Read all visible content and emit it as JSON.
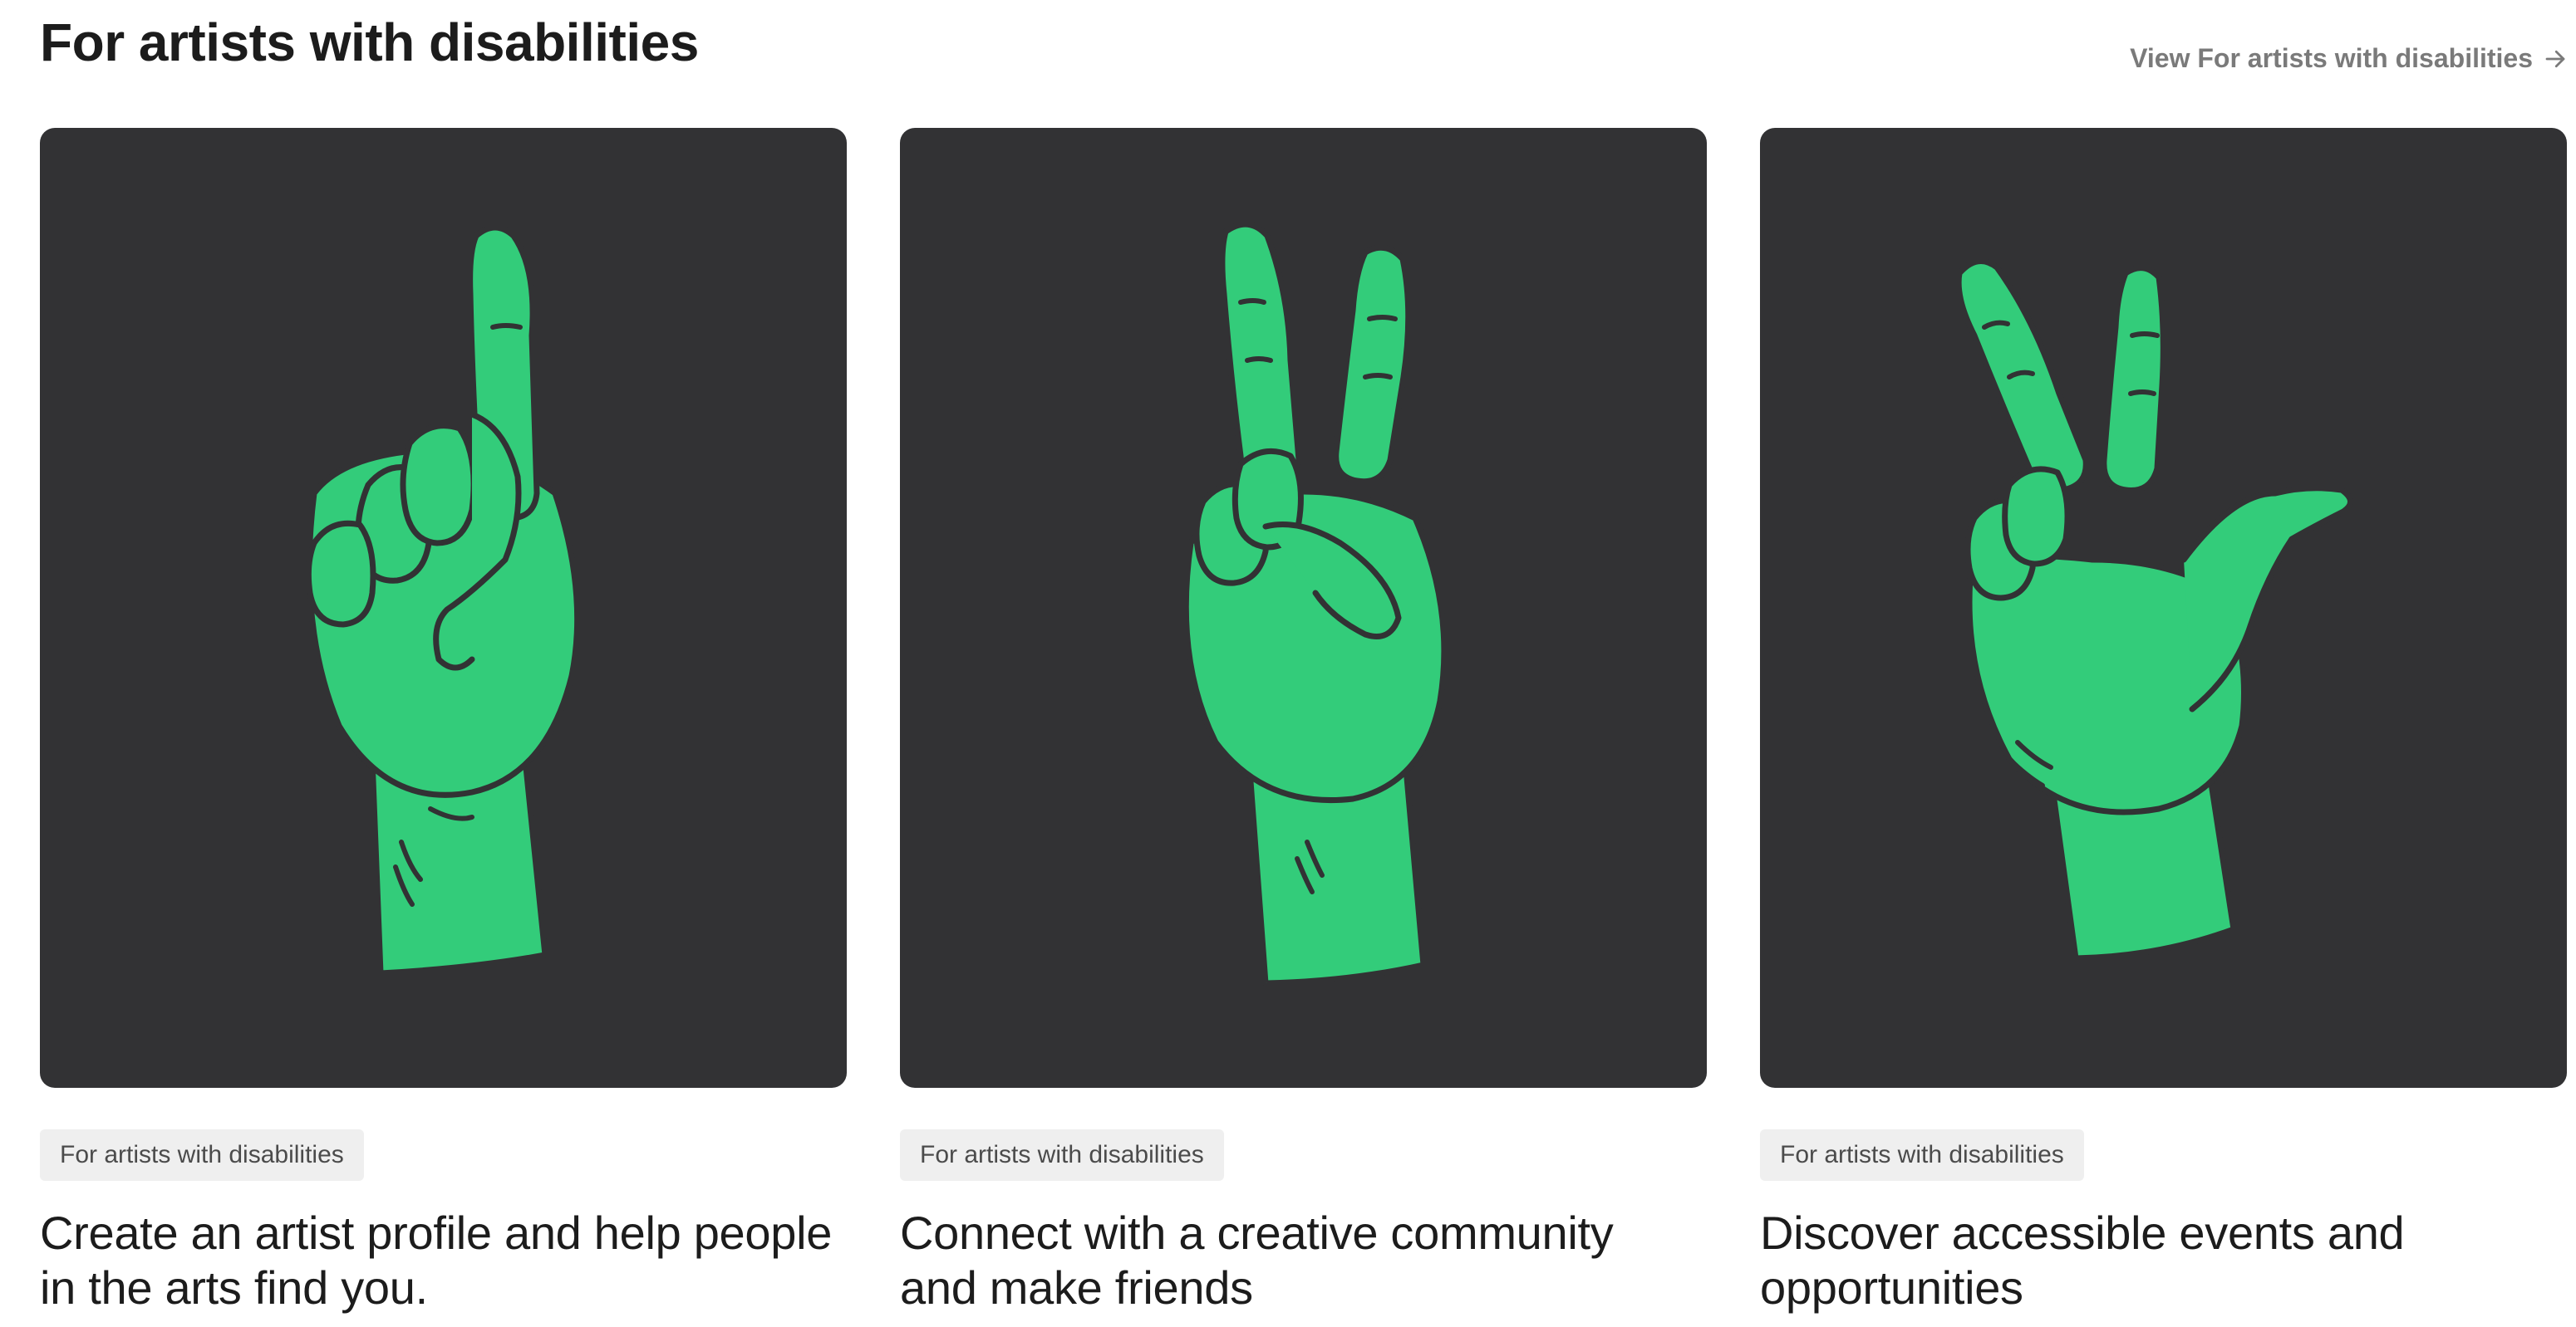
{
  "section": {
    "title": "For artists with disabilities",
    "view_all_label": "View For artists with disabilities",
    "view_all_icon": "arrow-right-icon"
  },
  "colors": {
    "card_background": "#323234",
    "hand_fill": "#33cc7a",
    "hand_line": "#323234",
    "tag_background": "#efefef",
    "link_color": "#7a7a7a"
  },
  "cards": [
    {
      "illustration": "hand-one-finger-icon",
      "tag": "For artists with disabilities",
      "title": "Create an artist profile and help people in the arts find you."
    },
    {
      "illustration": "hand-peace-sign-icon",
      "tag": "For artists with disabilities",
      "title": "Connect with a creative community and make friends"
    },
    {
      "illustration": "hand-three-fingers-icon",
      "tag": "For artists with disabilities",
      "title": "Discover accessible events and opportunities"
    }
  ]
}
